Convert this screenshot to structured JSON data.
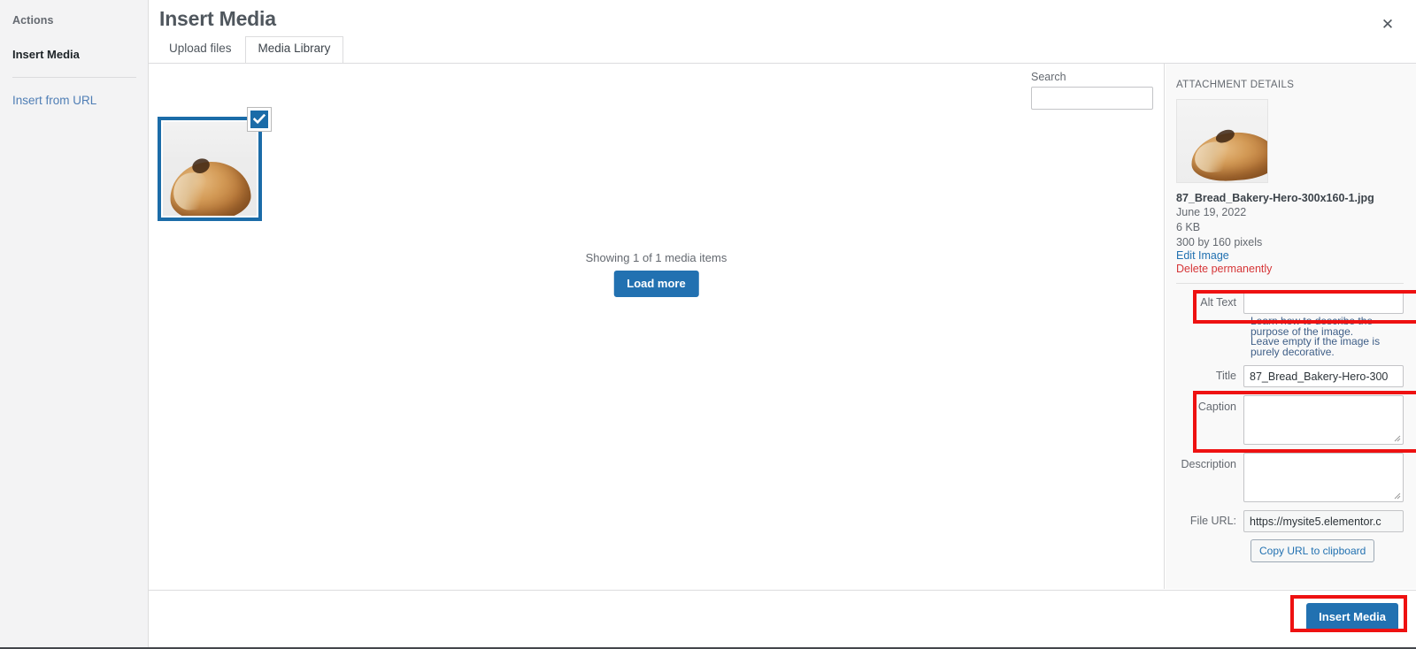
{
  "sidebar": {
    "heading": "Actions",
    "items": [
      {
        "label": "Insert Media",
        "name": "insert-media"
      }
    ],
    "link": "Insert from URL"
  },
  "header": {
    "title": "Insert Media",
    "close_icon": "close-icon",
    "close_glyph": "✕"
  },
  "tabs": [
    {
      "label": "Upload files",
      "active": false
    },
    {
      "label": "Media Library",
      "active": true
    }
  ],
  "browser": {
    "search": {
      "label": "Search",
      "value": "",
      "placeholder": ""
    },
    "status": "Showing 1 of 1 media items",
    "load_more_label": "Load more",
    "attachment": {
      "selected": true,
      "check_icon": "checkmark-icon",
      "alt": "Bread loaf photo"
    }
  },
  "details": {
    "heading": "ATTACHMENT DETAILS",
    "filename": "87_Bread_Bakery-Hero-300x160-1.jpg",
    "date": "June 19, 2022",
    "filesize": "6 KB",
    "dimensions": "300 by 160 pixels",
    "edit_image_label": "Edit Image",
    "delete_label": "Delete permanently",
    "fields": {
      "alt_text": {
        "label": "Alt Text",
        "value": "",
        "placeholder": ""
      },
      "alt_helper": "Learn how to describe the purpose of the image. Leave empty if the image is purely decorative.",
      "title": {
        "label": "Title",
        "value": "87_Bread_Bakery-Hero-300",
        "placeholder": ""
      },
      "caption": {
        "label": "Caption",
        "value": "",
        "placeholder": ""
      },
      "description": {
        "label": "Description",
        "value": "",
        "placeholder": ""
      },
      "file_url": {
        "label": "File URL:",
        "value": "https://mysite5.elementor.c",
        "placeholder": ""
      }
    },
    "copy_url_label": "Copy URL to clipboard"
  },
  "footer": {
    "insert_label": "Insert Media"
  },
  "colors": {
    "accent_blue": "#2271b1",
    "selection_blue": "#1b6ca8",
    "link_blue": "#4f7eb5",
    "danger_red": "#d63638",
    "highlight_red": "#ee1111",
    "sidebar_bg": "#f3f3f4",
    "panel_bg": "#f9f9f9"
  }
}
